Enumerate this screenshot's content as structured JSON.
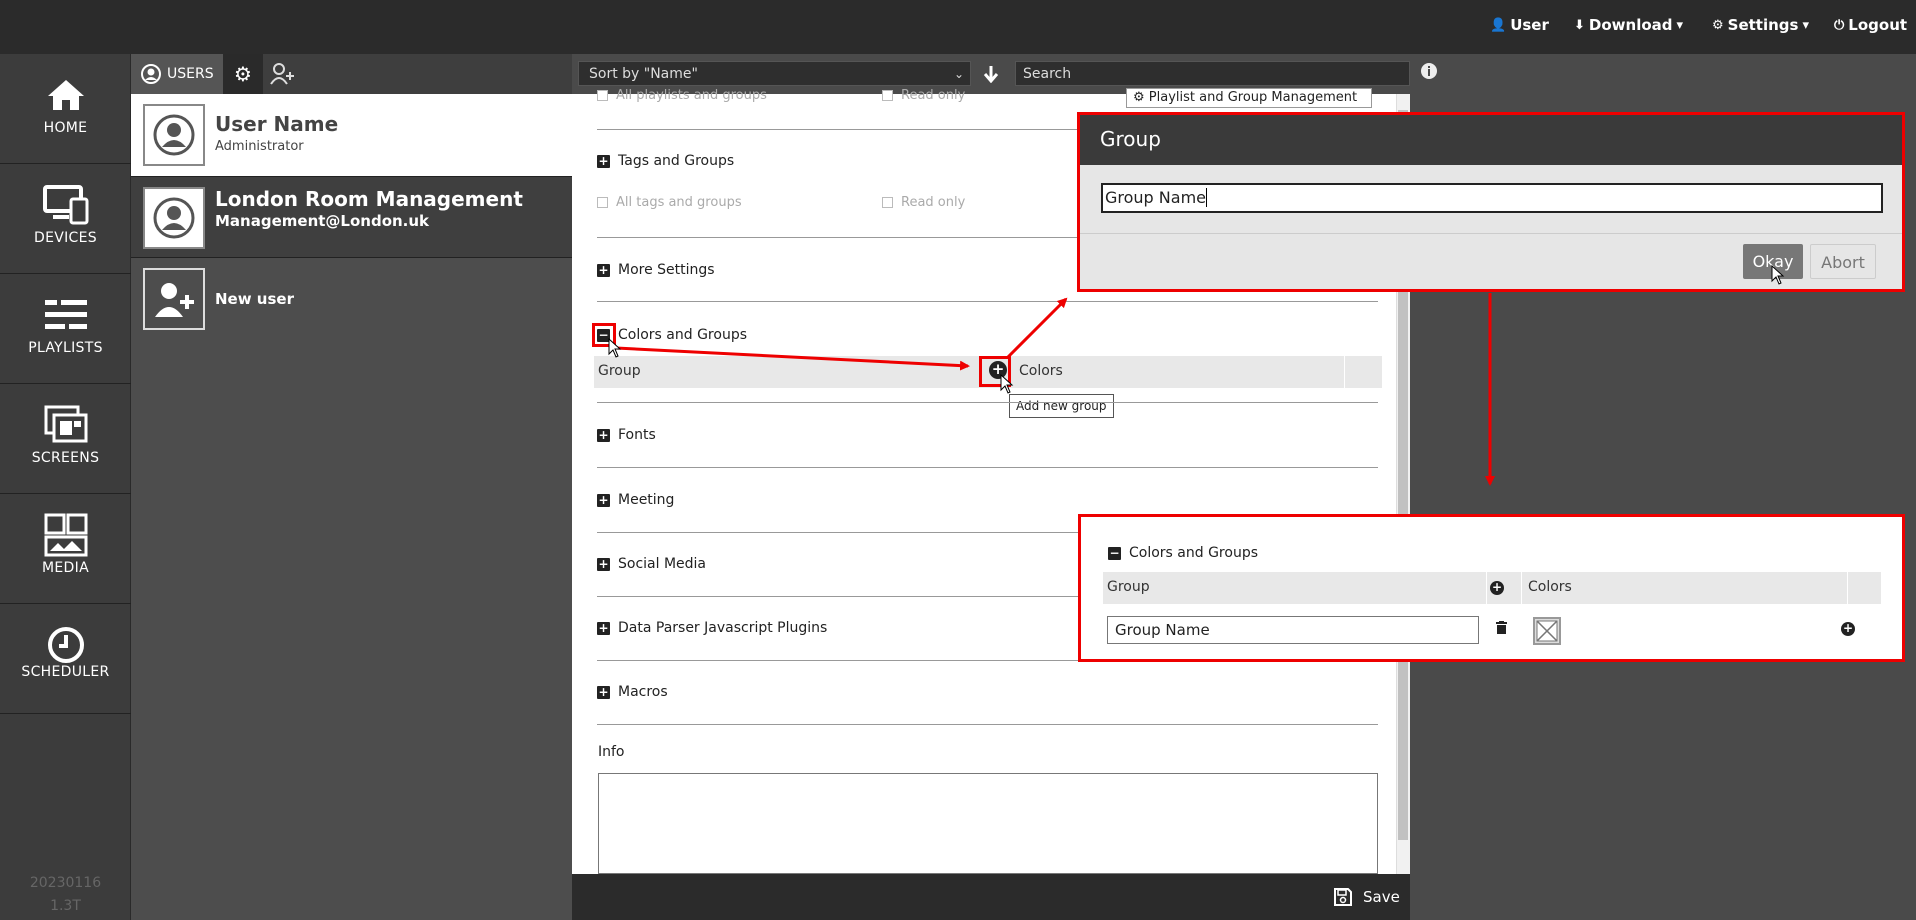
{
  "topbar": {
    "user_label": "User",
    "download_label": "Download",
    "settings_label": "Settings",
    "logout_label": "Logout"
  },
  "leftnav": {
    "items": [
      {
        "label": "HOME",
        "icon": "home-icon"
      },
      {
        "label": "DEVICES",
        "icon": "devices-icon"
      },
      {
        "label": "PLAYLISTS",
        "icon": "playlists-icon"
      },
      {
        "label": "SCREENS",
        "icon": "screens-icon"
      },
      {
        "label": "MEDIA",
        "icon": "media-icon"
      },
      {
        "label": "SCHEDULER",
        "icon": "scheduler-icon"
      }
    ],
    "version_line1": "20230116",
    "version_line2": "1.3T"
  },
  "users": {
    "tab_label": "USERS",
    "list": [
      {
        "name": "User Name",
        "sub": "Administrator"
      },
      {
        "name": "London Room Management",
        "sub": "Management@London.uk"
      }
    ],
    "new_user_label": "New user"
  },
  "toolbar": {
    "sort_value": "Sort by \"Name\"",
    "search_placeholder": "Search"
  },
  "settings": {
    "top_partial": {
      "all_playlists": "All playlists and groups",
      "read_only": "Read only",
      "pgm_label": "Playlist and Group Management"
    },
    "tags_groups": {
      "title": "Tags and Groups",
      "all_tags": "All tags and groups",
      "read_only": "Read only"
    },
    "more_settings": "More Settings",
    "colors_groups": {
      "title": "Colors and Groups",
      "col_group": "Group",
      "col_colors": "Colors",
      "tooltip": "Add new group"
    },
    "fonts": "Fonts",
    "meeting": "Meeting",
    "social_media": "Social Media",
    "data_parser": "Data Parser Javascript Plugins",
    "macros": "Macros",
    "info_label": "Info",
    "save_label": "Save"
  },
  "dialog": {
    "title": "Group",
    "input_value": "Group Name",
    "ok_label": "Okay",
    "abort_label": "Abort"
  },
  "preview": {
    "title": "Colors and Groups",
    "col_group": "Group",
    "col_colors": "Colors",
    "row_group_value": "Group Name"
  },
  "colors": {
    "accent_red": "#e00000",
    "topbar": "#2b2b2b",
    "sidebar": "#3c3c3c"
  }
}
